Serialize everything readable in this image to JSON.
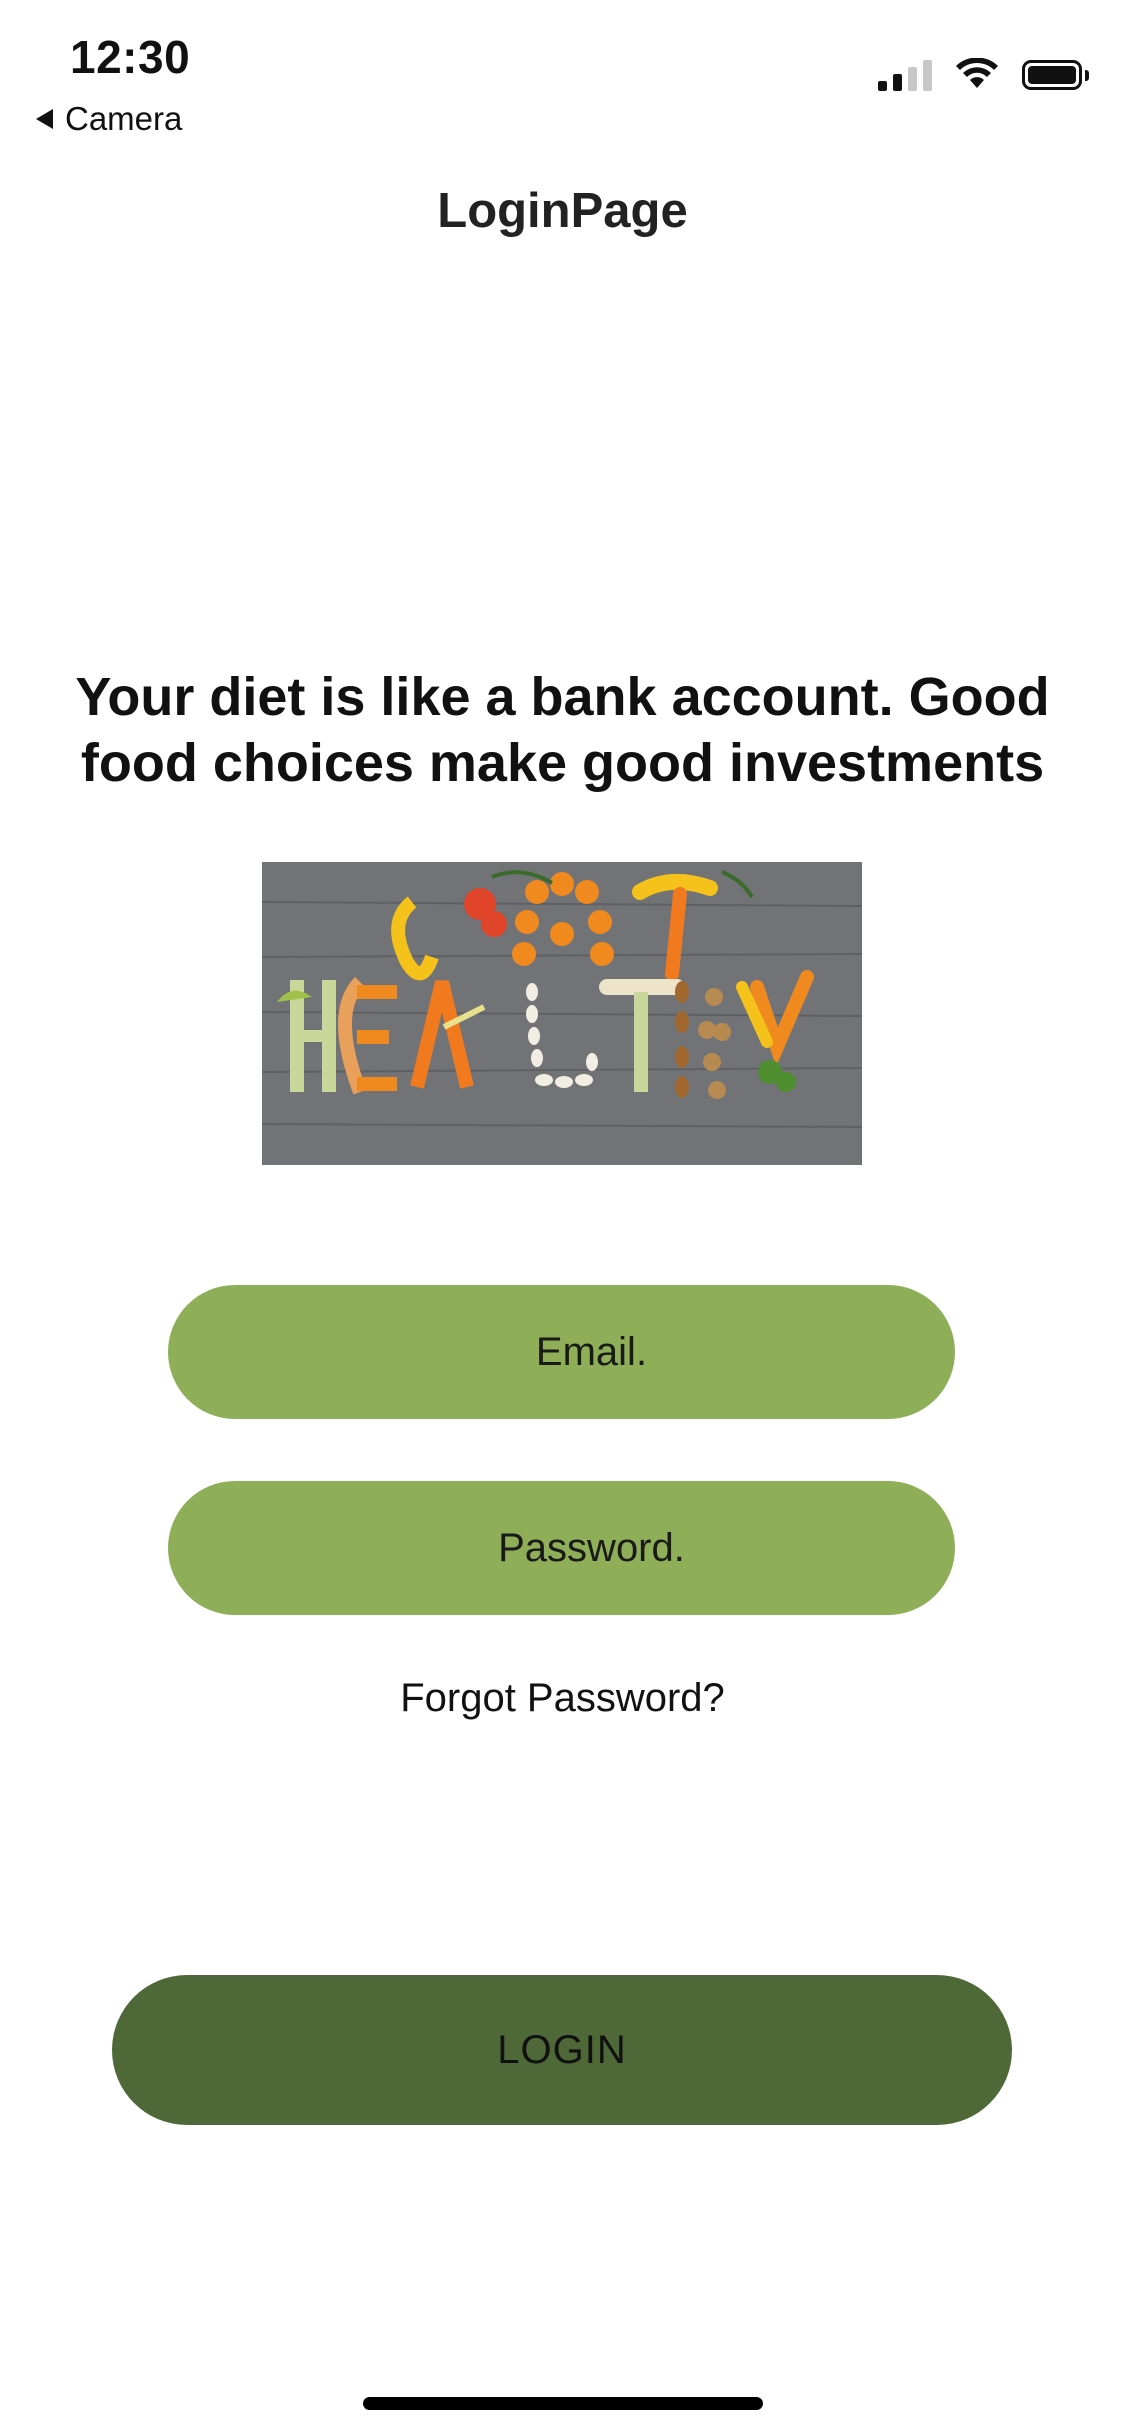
{
  "status_bar": {
    "time": "12:30",
    "back_label": "Camera",
    "icons": [
      "signal-icon",
      "wifi-icon",
      "battery-icon"
    ]
  },
  "nav": {
    "title": "LoginPage"
  },
  "quote": "Your diet is like a bank account. Good food choices make good investments",
  "hero_image": {
    "icon": "eat-healthy-image"
  },
  "form": {
    "email_label": "Email.",
    "password_label": "Password.",
    "forgot_label": "Forgot Password?",
    "login_label": "LOGIN"
  },
  "colors": {
    "field_green": "#8eaf58",
    "login_green": "#4e6937",
    "background": "#ffffff"
  }
}
